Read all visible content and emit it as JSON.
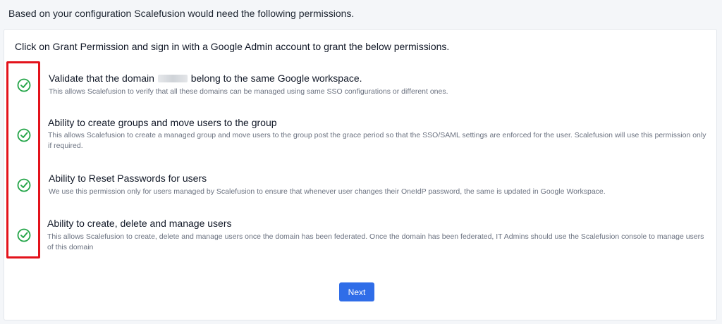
{
  "header": {
    "text": "Based on your configuration Scalefusion would need the following permissions."
  },
  "card": {
    "instruction": "Click on Grant Permission and sign in with a Google Admin account to grant the below permissions.",
    "permissions": [
      {
        "title_before": "Validate that the domain",
        "title_after": "belong to the same Google workspace.",
        "description": "This allows Scalefusion to verify that all these domains can be managed using same SSO configurations or different ones."
      },
      {
        "title": "Ability to create groups and move users to the group",
        "description": "This allows Scalefusion to create a managed group and move users to the group post the grace period so that the SSO/SAML settings are enforced for the user. Scalefusion will use this permission only if required."
      },
      {
        "title": "Ability to Reset Passwords for users",
        "description": "We use this permission only for users managed by Scalefusion to ensure that whenever user changes their OneIdP password, the same is updated in Google Workspace."
      },
      {
        "title": "Ability to create, delete and manage users",
        "description": "This allows Scalefusion to create, delete and manage users once the domain has been federated. Once the domain has been federated, IT Admins should use the Scalefusion console to manage users of this domain"
      }
    ],
    "next_label": "Next"
  },
  "colors": {
    "check": "#22a447",
    "highlight": "#e3121b",
    "button": "#2f6de8"
  },
  "icons": {
    "check": "check-circle-icon"
  }
}
